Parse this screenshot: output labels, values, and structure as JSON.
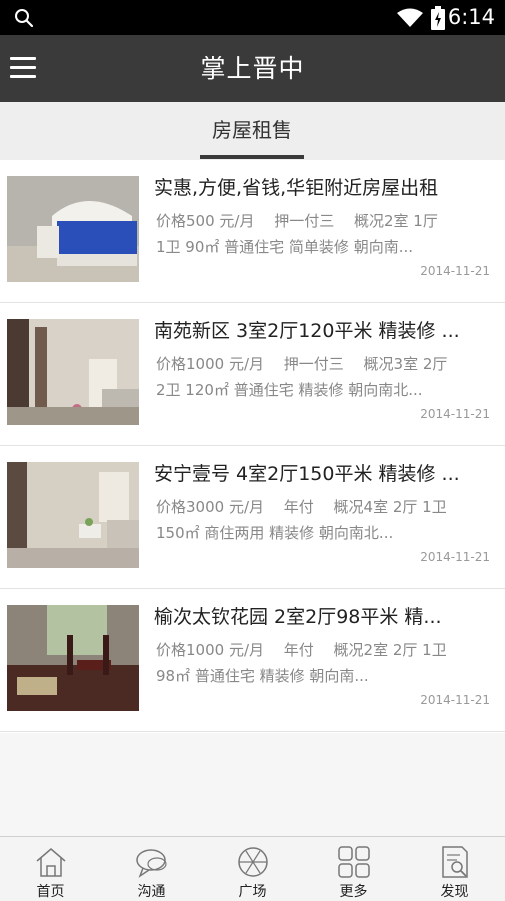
{
  "status_bar": {
    "time": "6:14"
  },
  "header": {
    "title": "掌上晋中"
  },
  "tabs": [
    {
      "label": "房屋租售",
      "active": true
    }
  ],
  "listings": [
    {
      "title": "实惠,方便,省钱,华钜附近房屋出租",
      "desc_line1": "价格500 元/月　 押一付三　 概况2室 1厅",
      "desc_line2": "1卫 90㎡ 普通住宅 简单装修 朝向南...",
      "date": "2014-11-21"
    },
    {
      "title": "南苑新区 3室2厅120平米 精装修 ...",
      "desc_line1": "价格1000 元/月　 押一付三　 概况3室 2厅",
      "desc_line2": "2卫 120㎡ 普通住宅 精装修 朝向南北...",
      "date": "2014-11-21"
    },
    {
      "title": "安宁壹号 4室2厅150平米 精装修 ...",
      "desc_line1": "价格3000 元/月　 年付　 概况4室 2厅 1卫",
      "desc_line2": "150㎡ 商住两用 精装修 朝向南北...",
      "date": "2014-11-21"
    },
    {
      "title": "榆次太钦花园 2室2厅98平米 精...",
      "desc_line1": "价格1000 元/月　 年付　 概况2室 2厅 1卫",
      "desc_line2": "98㎡ 普通住宅 精装修 朝向南...",
      "date": "2014-11-21"
    }
  ],
  "bottom_nav": [
    {
      "label": "首页",
      "icon": "home-icon"
    },
    {
      "label": "沟通",
      "icon": "chat-icon"
    },
    {
      "label": "广场",
      "icon": "plaza-icon"
    },
    {
      "label": "更多",
      "icon": "grid-icon"
    },
    {
      "label": "发现",
      "icon": "discover-icon"
    }
  ],
  "colors": {
    "status_bar": "#000000",
    "title_bar": "#3a3a3a",
    "tab_bg": "#eeeeee",
    "tab_indicator": "#3a3a3a",
    "list_bg": "#ffffff"
  }
}
